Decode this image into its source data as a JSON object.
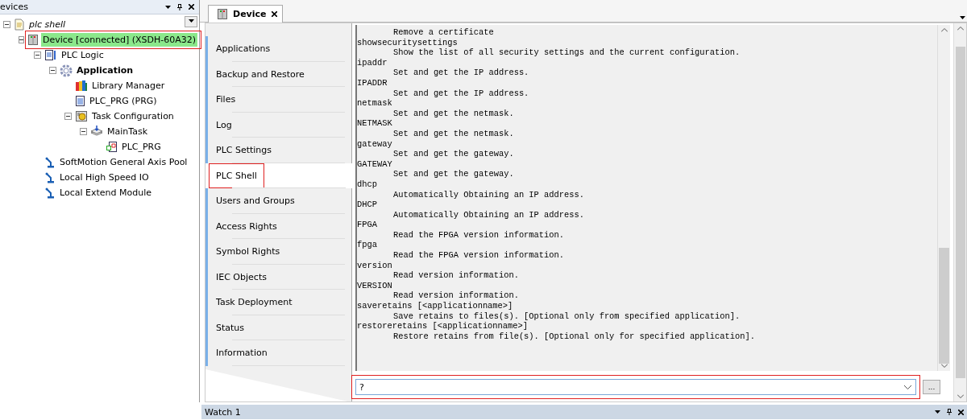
{
  "devices_panel": {
    "title": "evices",
    "tree": [
      {
        "label": "plc shell",
        "kind": "project",
        "expanded": true,
        "children": [
          {
            "label": "Device [connected] (XSDH-60A32)",
            "kind": "device",
            "expanded": true,
            "connected": true,
            "annotated": true,
            "children": [
              {
                "label": "PLC Logic",
                "kind": "logic",
                "expanded": true,
                "children": [
                  {
                    "label": "Application",
                    "kind": "application",
                    "expanded": true,
                    "active": true,
                    "children": [
                      {
                        "label": "Library Manager",
                        "kind": "library"
                      },
                      {
                        "label": "PLC_PRG (PRG)",
                        "kind": "pou"
                      },
                      {
                        "label": "Task Configuration",
                        "kind": "task-config",
                        "expanded": true,
                        "children": [
                          {
                            "label": "MainTask",
                            "kind": "task",
                            "expanded": true,
                            "children": [
                              {
                                "label": "PLC_PRG",
                                "kind": "program-call"
                              }
                            ]
                          }
                        ]
                      }
                    ]
                  }
                ]
              },
              {
                "label": "SoftMotion General Axis Pool",
                "kind": "module"
              },
              {
                "label": "Local High Speed IO",
                "kind": "module"
              },
              {
                "label": "Local Extend Module",
                "kind": "module"
              }
            ]
          }
        ]
      }
    ]
  },
  "editor": {
    "tabs": [
      {
        "label": "Device",
        "selected": true
      }
    ],
    "nav_items": [
      {
        "label": "Applications",
        "selected": false
      },
      {
        "label": "Backup and Restore",
        "selected": false
      },
      {
        "label": "Files",
        "selected": false
      },
      {
        "label": "Log",
        "selected": false
      },
      {
        "label": "PLC Settings",
        "selected": false
      },
      {
        "label": "PLC Shell",
        "selected": true,
        "annotated": true
      },
      {
        "label": "Users and Groups",
        "selected": false
      },
      {
        "label": "Access Rights",
        "selected": false
      },
      {
        "label": "Symbol Rights",
        "selected": false
      },
      {
        "label": "IEC Objects",
        "selected": false
      },
      {
        "label": "Task Deployment",
        "selected": false
      },
      {
        "label": "Status",
        "selected": false
      },
      {
        "label": "Information",
        "selected": false
      }
    ],
    "console_lines": [
      {
        "kind": "description",
        "text": "Remove a certificate"
      },
      {
        "kind": "command",
        "text": "showsecuritysettings"
      },
      {
        "kind": "description",
        "text": "Show the list of all security settings and the current configuration."
      },
      {
        "kind": "command",
        "text": "ipaddr"
      },
      {
        "kind": "description",
        "text": "Set and get the IP address."
      },
      {
        "kind": "command",
        "text": "IPADDR"
      },
      {
        "kind": "description",
        "text": "Set and get the IP address."
      },
      {
        "kind": "command",
        "text": "netmask"
      },
      {
        "kind": "description",
        "text": "Set and get the netmask."
      },
      {
        "kind": "command",
        "text": "NETMASK"
      },
      {
        "kind": "description",
        "text": "Set and get the netmask."
      },
      {
        "kind": "command",
        "text": "gateway"
      },
      {
        "kind": "description",
        "text": "Set and get the gateway."
      },
      {
        "kind": "command",
        "text": "GATEWAY"
      },
      {
        "kind": "description",
        "text": "Set and get the gateway."
      },
      {
        "kind": "command",
        "text": "dhcp"
      },
      {
        "kind": "description",
        "text": "Automatically Obtaining an IP address."
      },
      {
        "kind": "command",
        "text": "DHCP"
      },
      {
        "kind": "description",
        "text": "Automatically Obtaining an IP address."
      },
      {
        "kind": "command",
        "text": "FPGA"
      },
      {
        "kind": "description",
        "text": "Read the FPGA version information."
      },
      {
        "kind": "command",
        "text": "fpga"
      },
      {
        "kind": "description",
        "text": "Read the FPGA version information."
      },
      {
        "kind": "command",
        "text": "version"
      },
      {
        "kind": "description",
        "text": "Read version information."
      },
      {
        "kind": "command",
        "text": "VERSION"
      },
      {
        "kind": "description",
        "text": "Read version information."
      },
      {
        "kind": "command",
        "text": "saveretains [<applicationname>]"
      },
      {
        "kind": "description",
        "text": "Save retains to files(s). [Optional only from specified application]."
      },
      {
        "kind": "command",
        "text": "restoreretains [<applicationname>]"
      },
      {
        "kind": "description",
        "text": "Restore retains from file(s). [Optional only for specified application]."
      }
    ],
    "command_input": {
      "value": "?",
      "annotated": true
    },
    "browse_button": "..."
  },
  "watch_panel": {
    "title": "Watch 1"
  }
}
